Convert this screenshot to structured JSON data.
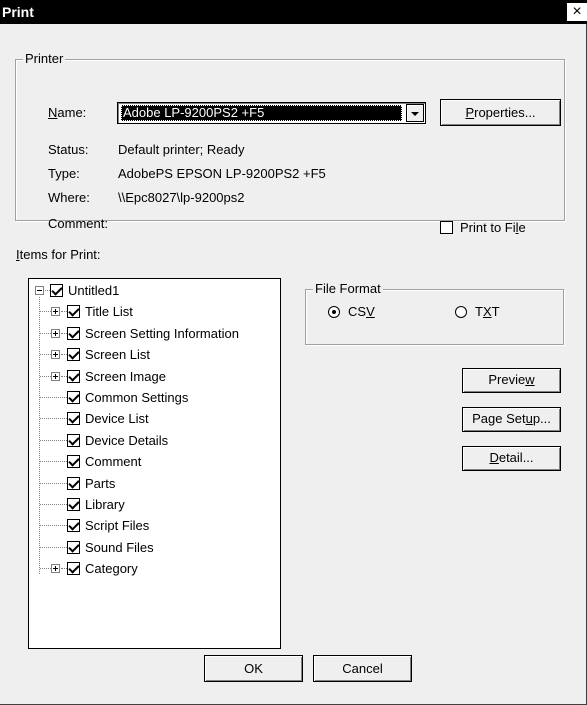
{
  "title": "Print",
  "close_glyph": "×",
  "printer": {
    "legend": "Printer",
    "name_label_key": "N",
    "name_label_rest": "ame:",
    "name_value": "Adobe LP-9200PS2 +F5",
    "properties_key": "P",
    "properties_rest": "roperties...",
    "status_label": "Status:",
    "status_value": "Default printer; Ready",
    "type_label": "Type:",
    "type_value": "AdobePS EPSON LP-9200PS2 +F5",
    "where_label": "Where:",
    "where_value": "\\\\Epc8027\\lp-9200ps2",
    "comment_label": "Comment:",
    "print_to_file_pre": "Print to Fi",
    "print_to_file_key": "l",
    "print_to_file_post": "e",
    "print_to_file_checked": false
  },
  "items_label_key": "I",
  "items_label_rest": "tems for Print:",
  "tree": {
    "root": "Untitled1",
    "items": [
      {
        "label": "Title List",
        "expandable": true
      },
      {
        "label": "Screen Setting Information",
        "expandable": true
      },
      {
        "label": "Screen List",
        "expandable": true
      },
      {
        "label": "Screen Image",
        "expandable": true
      },
      {
        "label": "Common Settings",
        "expandable": false
      },
      {
        "label": "Device List",
        "expandable": false
      },
      {
        "label": "Device Details",
        "expandable": false
      },
      {
        "label": "Comment",
        "expandable": false
      },
      {
        "label": "Parts",
        "expandable": false
      },
      {
        "label": "Library",
        "expandable": false
      },
      {
        "label": "Script Files",
        "expandable": false
      },
      {
        "label": "Sound Files",
        "expandable": false
      },
      {
        "label": "Category",
        "expandable": true
      }
    ]
  },
  "file_format": {
    "legend": "File Format",
    "csv_pre": "CS",
    "csv_key": "V",
    "txt_pre": "T",
    "txt_key": "X",
    "txt_post": "T",
    "selected": "CSV"
  },
  "buttons": {
    "preview_pre": "Previe",
    "preview_key": "w",
    "page_setup_pre": "Page Set",
    "page_setup_key": "u",
    "page_setup_post": "p...",
    "detail_key": "D",
    "detail_rest": "etail...",
    "ok": "OK",
    "cancel": "Cancel"
  }
}
